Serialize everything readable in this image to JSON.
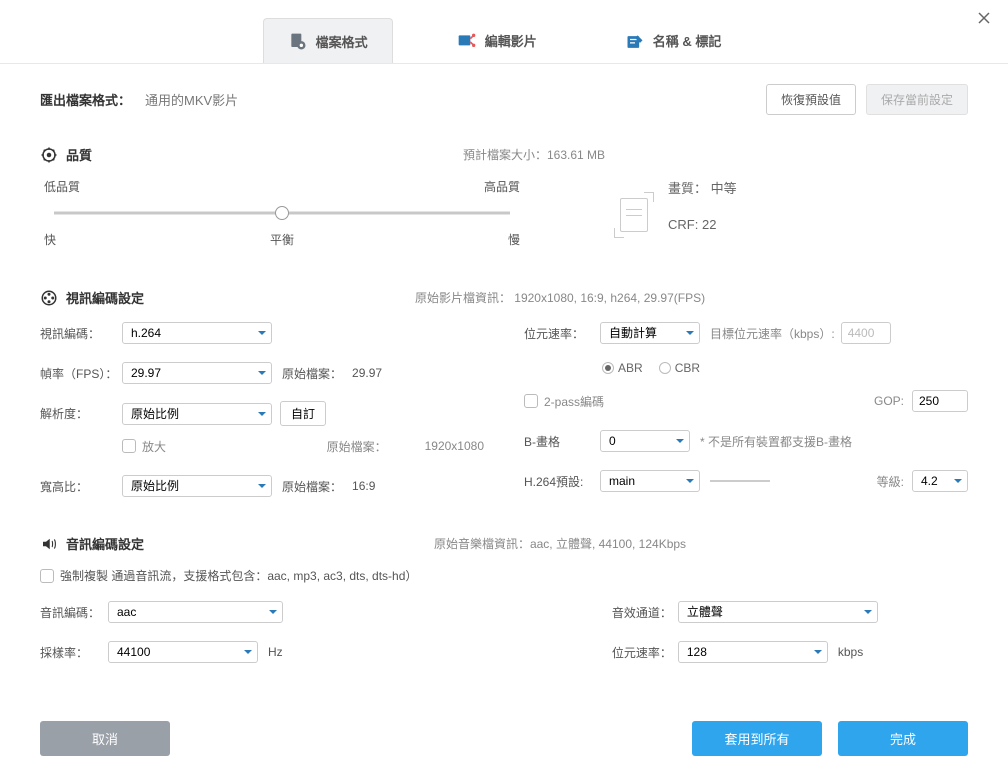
{
  "tabs": {
    "format": "檔案格式",
    "edit": "編輯影片",
    "name": "名稱 & 標記"
  },
  "export": {
    "label": "匯出檔案格式：",
    "format": "通用的MKV影片",
    "restore": "恢復預設值",
    "save": "保存當前設定"
  },
  "quality": {
    "title": "品質",
    "estimate_label": "預計檔案大小：",
    "estimate_value": "163.61 MB",
    "low": "低品質",
    "high": "高品質",
    "fast": "快",
    "balance": "平衡",
    "slow": "慢",
    "vq_label": "畫質：",
    "vq_value": "中等",
    "crf_label": "CRF:",
    "crf_value": "22"
  },
  "video": {
    "title": "視訊編碼設定",
    "source_info": "原始影片檔資訊：  1920x1080, 16:9, h264, 29.97(FPS)",
    "codec_label": "視訊編碼：",
    "codec_value": "h.264",
    "fps_label": "幀率（FPS）：",
    "fps_value": "29.97",
    "fps_source_label": "原始檔案：",
    "fps_source_value": "29.97",
    "res_label": "解析度：",
    "res_value": "原始比例",
    "custom_btn": "自訂",
    "enlarge": "放大",
    "res_source_label": "原始檔案：",
    "res_source_value": "1920x1080",
    "aspect_label": "寬高比：",
    "aspect_value": "原始比例",
    "aspect_source_label": "原始檔案：",
    "aspect_source_value": "16:9",
    "bitrate_label": "位元速率：",
    "bitrate_value": "自動計算",
    "target_bitrate_label": "目標位元速率（kbps）:",
    "target_bitrate_value": "4400",
    "abr": "ABR",
    "cbr": "CBR",
    "twopass": "2-pass編碼",
    "gop_label": "GOP:",
    "gop_value": "250",
    "bframe_label": "B-畫格",
    "bframe_value": "0",
    "bframe_note": "* 不是所有裝置都支援B-畫格",
    "preset_label": "H.264預設:",
    "preset_value": "main",
    "level_label": "等級:",
    "level_value": "4.2"
  },
  "audio": {
    "title": "音訊編碼設定",
    "source_info": "原始音樂檔資訊：aac, 立體聲, 44100, 124Kbps",
    "copy_label": "強制複製 通過音訊流，支援格式包含：aac, mp3, ac3, dts, dts-hd）",
    "codec_label": "音訊編碼：",
    "codec_value": "aac",
    "sample_label": "採樣率：",
    "sample_value": "44100",
    "hz": "Hz",
    "channel_label": "音效通道：",
    "channel_value": "立體聲",
    "bitrate_label": "位元速率：",
    "bitrate_value": "128",
    "kbps": "kbps"
  },
  "buttons": {
    "cancel": "取消",
    "apply_all": "套用到所有",
    "done": "完成"
  }
}
